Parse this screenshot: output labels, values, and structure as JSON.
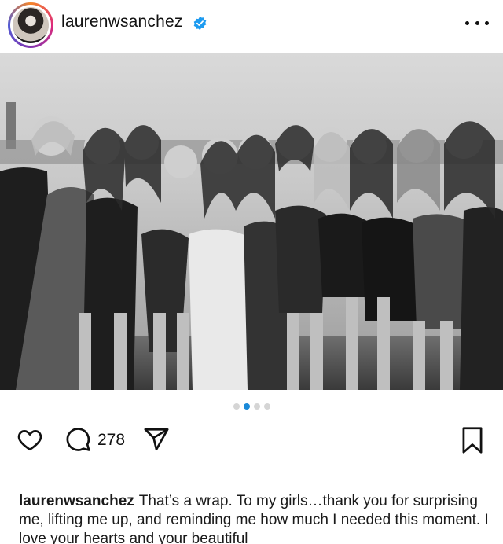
{
  "post": {
    "username": "laurenwsanchez",
    "verified": true,
    "more_icon": "more-horizontal-icon",
    "carousel": {
      "total": 4,
      "active_index": 1
    },
    "actions": {
      "like_icon": "heart-icon",
      "comment_icon": "comment-icon",
      "comment_count": "278",
      "share_icon": "paper-plane-icon",
      "save_icon": "bookmark-icon"
    },
    "caption": {
      "username": "laurenwsanchez",
      "text": "That’s a wrap. To my girls…thank you for surprising me, lifting me up, and reminding me how much I needed this moment. I love your hearts and your beautiful"
    }
  },
  "colors": {
    "accent": "#1a8ad8",
    "verified": "#1d9bf0"
  }
}
